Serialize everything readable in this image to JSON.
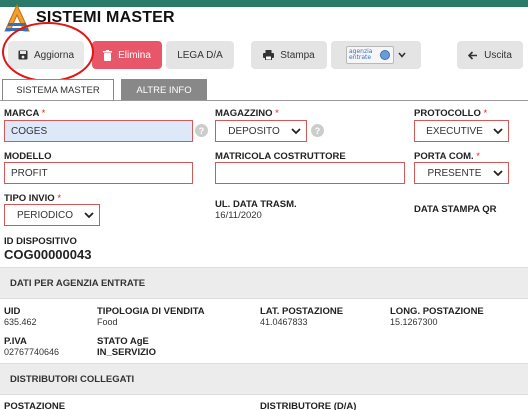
{
  "header": {
    "title": "SISTEMI MASTER"
  },
  "toolbar": {
    "aggiorna": "Aggiorna",
    "elimina": "Elimina",
    "lega": "LEGA D/A",
    "stampa": "Stampa",
    "agenzia_logo_text": "agenzia\nentrate",
    "uscita": "Uscita"
  },
  "tabs": [
    {
      "label": "SISTEMA MASTER",
      "active": true
    },
    {
      "label": "ALTRE INFO",
      "active": false
    }
  ],
  "form": {
    "marca": {
      "label": "MARCA",
      "value": "COGES",
      "required": "*"
    },
    "magazzino": {
      "label": "MAGAZZINO",
      "value": "DEPOSITO",
      "required": "*"
    },
    "protocollo": {
      "label": "PROTOCOLLO",
      "value": "EXECUTIVE",
      "required": "*"
    },
    "modello": {
      "label": "MODELLO",
      "value": "PROFIT"
    },
    "matricola": {
      "label": "MATRICOLA COSTRUTTORE",
      "value": ""
    },
    "porta_com": {
      "label": "PORTA COM.",
      "value": "PRESENTE",
      "required": "*"
    },
    "tipo_invio": {
      "label": "TIPO INVIO",
      "value": "PERIODICO",
      "required": "*"
    },
    "ul_data_trasm": {
      "label": "UL. DATA TRASM.",
      "value": "16/11/2020"
    },
    "data_stampa_qr": {
      "label": "DATA STAMPA QR",
      "value": ""
    },
    "id_dispositivo": {
      "label": "ID DISPOSITIVO",
      "value": "COG00000043"
    },
    "help_glyph": "?"
  },
  "agenzia": {
    "section_title": "DATI PER AGENZIA ENTRATE",
    "uid": {
      "label": "UID",
      "value": "635.462"
    },
    "tipologia": {
      "label": "TIPOLOGIA DI VENDITA",
      "value": "Food"
    },
    "lat": {
      "label": "LAT. POSTAZIONE",
      "value": "41.0467833"
    },
    "long": {
      "label": "LONG. POSTAZIONE",
      "value": "15.1267300"
    },
    "piva": {
      "label": "P.IVA",
      "value": "02767740646"
    },
    "stato": {
      "label": "STATO AgE",
      "value": "IN_SERVIZIO"
    }
  },
  "distributori": {
    "section_title": "DISTRIBUTORI COLLEGATI",
    "col_postazione": "POSTAZIONE",
    "col_distributore": "DISTRIBUTORE (D/A)"
  },
  "colors": {
    "accent_red": "#e8566a",
    "required_border": "#d05a5a",
    "topbar": "#2a7a6a",
    "annotation_circle": "#e01515"
  }
}
